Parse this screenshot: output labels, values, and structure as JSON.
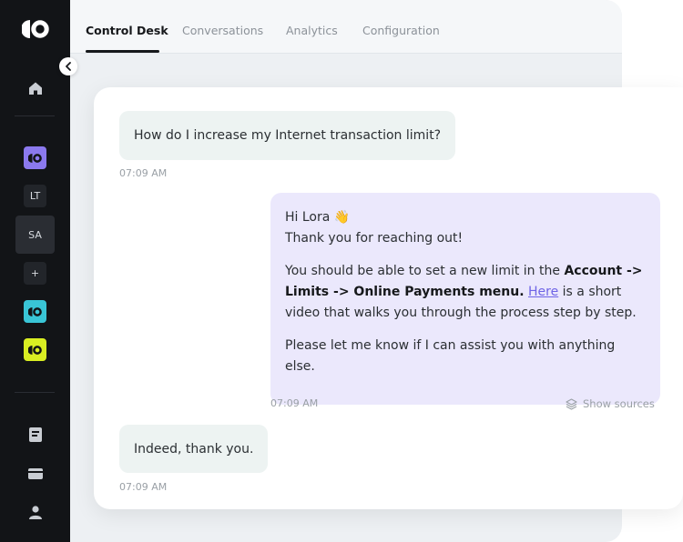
{
  "tabs": [
    "Control Desk",
    "Conversations",
    "Analytics",
    "Configuration"
  ],
  "workspaces": {
    "lt": "LT",
    "sa": "SA",
    "add": "+"
  },
  "messages": {
    "user1": {
      "text": "How do I increase my Internet transaction limit?",
      "time": "07:09 AM"
    },
    "bot": {
      "greeting": "Hi Lora",
      "wave": "👋",
      "line2": "Thank you for reaching out!",
      "p1_start": "You should be able to set a new limit in the ",
      "p1_bold": "Account -> Limits -> Online Payments menu.",
      "p1_link": "Here",
      "p1_end": " is a short video that walks you through the process step by step.",
      "p2": "Please let me know if I can assist you with anything else.",
      "time": "07:09 AM",
      "sources_label": "Show sources"
    },
    "user2": {
      "text": "Indeed, thank you.",
      "time": "07:09 AM"
    }
  },
  "colors": {
    "sidebar_bg": "#121417",
    "ws_purple": "#8b79ee",
    "ws_teal": "#39c5d6",
    "ws_lime": "#d9ee22",
    "bot_bubble": "#ebe8fc",
    "user_bubble": "#edf3f2",
    "link": "#6f64e6"
  },
  "icons": [
    "brand-logo-icon",
    "home-icon",
    "collapse-chevron-icon",
    "document-icon",
    "card-icon",
    "user-icon",
    "layers-icon"
  ]
}
